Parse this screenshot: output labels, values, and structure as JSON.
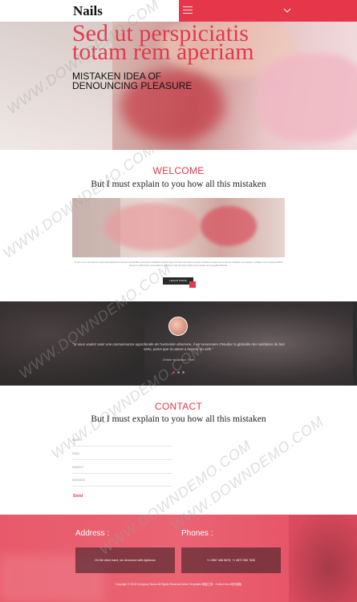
{
  "header": {
    "logo": "Nails",
    "menu_icon": "hamburger-icon",
    "toggle_icon": "chevron-down-icon"
  },
  "hero": {
    "title_line1": "Sed ut perspiciatis",
    "title_line2": "totam rem aperiam",
    "subtitle_line1": "MISTAKEN IDEA OF",
    "subtitle_line2": "DENOUNCING PLEASURE"
  },
  "welcome": {
    "heading": "WELCOME",
    "subheading": "But I must explain to you how all this mistaken",
    "paragraph": "At vero eos et accusamus et iusto odio dignissimos ducimus qui blanditiis praesentium voluptatum deleniti atque corrupti quos dolores et quas molestias excepturi sint occaecati cupiditate non provident, similique sunt in culpa qui officia deserunt mollitia animi, id est laborum et dolorum fuga. Et harum quidem rerum facilis est et expedita distinctio.",
    "button": "LEARN MORE"
  },
  "testimonial": {
    "quote": "\"Si vous voulez avoir une connaissance approfondie de l'extremite observee, il est necessaire d'etudier la globalite des solidaires de bon sens, parce que la nature a horreur du vide.\"",
    "author": "Zelaide de Bassus, Paris"
  },
  "contact": {
    "heading": "CONTACT",
    "subheading": "But I must explain to you how all this mistaken",
    "fields": [
      "NAME",
      "EMAIL",
      "SUBJECT",
      "MESSAGE"
    ],
    "send": "Send"
  },
  "footer": {
    "address_title": "Address :",
    "address_text": "On the other hand, we denounce with righteous",
    "phones_title": "Phones :",
    "phones_text": "+1 2567 468 5678, +1 4872 966 7845",
    "copyright": "Copyright © 2015 Company Name All Rights Reserved More Templates 模板之家 - Collect from 网页模板"
  },
  "watermark": "WWW.DOWNDEMO.COM",
  "colors": {
    "accent": "#e23a4e",
    "dark": "#2d2c2c",
    "footer": "#e85a6b"
  }
}
